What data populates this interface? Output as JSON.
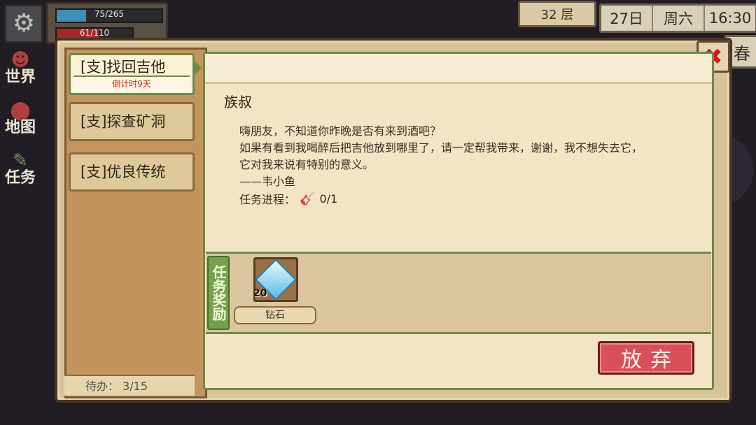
{
  "hud": {
    "hp_text": "75/265",
    "hp_fraction": 0.283,
    "mp_text": "61/110",
    "mp_fraction": 0.555,
    "floor": "32 层",
    "day": "27日",
    "weekday": "周六",
    "time": "16:30",
    "season": "春",
    "settings_icon": "gear-icon"
  },
  "sidenav": [
    {
      "icon": "people-icon",
      "label": "世界"
    },
    {
      "icon": "map-pin-icon",
      "label": "地图"
    },
    {
      "icon": "quest-scroll-icon",
      "label": "任务"
    }
  ],
  "quests": {
    "tabs": [
      {
        "label": "[支]找回吉他",
        "countdown": "倒计时9天",
        "active": true
      },
      {
        "label": "[支]探查矿洞",
        "active": false
      },
      {
        "label": "[支]优良传统",
        "active": false
      }
    ],
    "pending": "待办： 3/15"
  },
  "detail": {
    "npc": "族叔",
    "lines": [
      "嗨朋友，不知道你昨晚是否有来到酒吧？",
      "如果有看到我喝醉后把吉他放到哪里了，请一定帮我带来，谢谢，我不想失去它，",
      "它对我来说有特别的意义。",
      "——韦小鱼"
    ],
    "progress_label": "任务进程：",
    "progress_icon": "guitar-icon",
    "progress_value": "0/1"
  },
  "reward": {
    "tag": "任务奖励",
    "item_name": "钻石",
    "item_qty": "20",
    "item_icon": "diamond-icon"
  },
  "buttons": {
    "abandon": "放弃",
    "close_icon": "close-icon"
  },
  "colors": {
    "accent_green": "#6b8a4a",
    "abandon_red": "#d8505a",
    "countdown_red": "#d02020"
  }
}
